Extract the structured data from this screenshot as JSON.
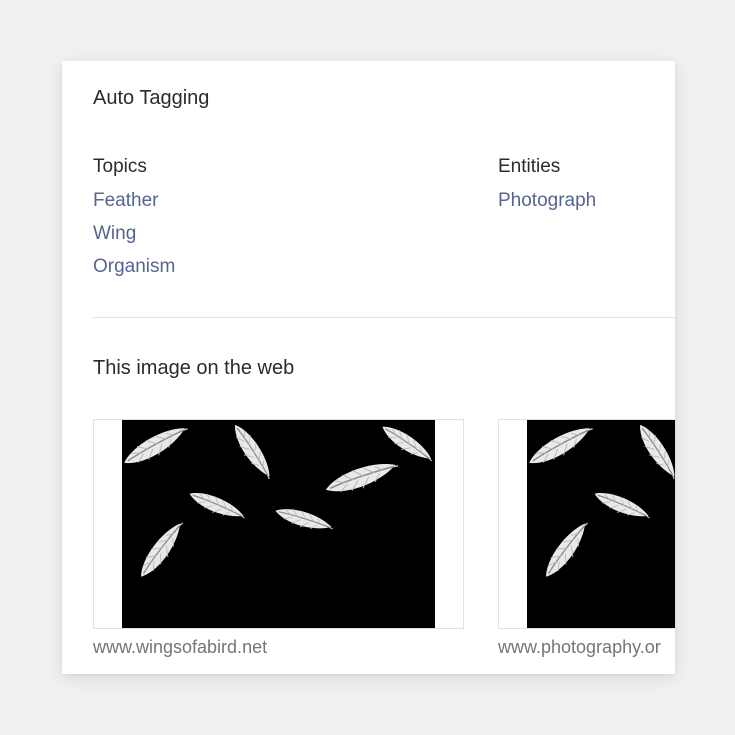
{
  "auto_tagging": {
    "title": "Auto Tagging",
    "topics": {
      "title": "Topics",
      "items": [
        "Feather",
        "Wing",
        "Organism"
      ]
    },
    "entities": {
      "title": "Entities",
      "items": [
        "Photograph"
      ]
    }
  },
  "web_section": {
    "title": "This image on the web",
    "results": [
      {
        "source": "www.wingsofabird.net",
        "thumbnail_icon": "feathers-on-black-photo"
      },
      {
        "source": "www.photography.or",
        "thumbnail_icon": "feathers-on-black-photo"
      }
    ]
  },
  "colors": {
    "page_background": "#f1f1f1",
    "card_background": "#ffffff",
    "heading_text": "#2b2b2b",
    "tag_link": "#54668f",
    "source_text": "#757575",
    "photo_background": "#000000",
    "feather": "#e8e8e8"
  }
}
